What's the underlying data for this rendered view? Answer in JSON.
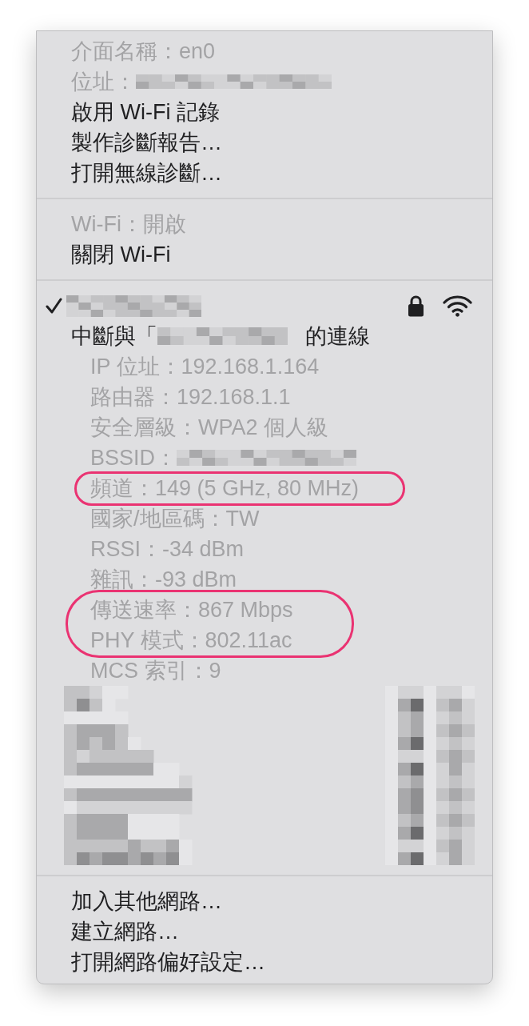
{
  "menu": {
    "sections": [
      {
        "items": [
          {
            "kind": "text",
            "label": "介面名稱：en0",
            "disabled": true
          },
          {
            "kind": "redacted",
            "label": "位址：",
            "disabled": true
          },
          {
            "kind": "text",
            "label": "啟用 Wi-Fi 記錄",
            "disabled": false
          },
          {
            "kind": "text",
            "label": "製作診斷報告…",
            "disabled": false
          },
          {
            "kind": "text",
            "label": "打開無線診斷…",
            "disabled": false
          }
        ]
      },
      {
        "items": [
          {
            "kind": "text",
            "label": "Wi-Fi：開啟",
            "disabled": true
          },
          {
            "kind": "text",
            "label": "關閉 Wi-Fi",
            "disabled": false
          }
        ]
      },
      {
        "items": [
          {
            "kind": "network",
            "checked": true,
            "locked": true
          },
          {
            "kind": "split",
            "label_start": "中斷與「",
            "label_end": "的連線",
            "disabled": false,
            "children": [
              {
                "kind": "text",
                "label": "IP 位址：192.168.1.164",
                "disabled": true,
                "circled": false
              },
              {
                "kind": "text",
                "label": "路由器：192.168.1.1",
                "disabled": true,
                "circled": false
              },
              {
                "kind": "text",
                "label": "安全層級：WPA2 個人級",
                "disabled": true,
                "circled": false
              },
              {
                "kind": "redacted",
                "label": "BSSID：",
                "disabled": true,
                "circled": false
              },
              {
                "kind": "text",
                "label": "頻道：149 (5 GHz, 80 MHz)",
                "disabled": true,
                "circled": true
              },
              {
                "kind": "text",
                "label": "國家/地區碼：TW",
                "disabled": true,
                "circled": false
              },
              {
                "kind": "text",
                "label": "RSSI：-34 dBm",
                "disabled": true,
                "circled": false
              },
              {
                "kind": "text",
                "label": "雜訊：-93 dBm",
                "disabled": true,
                "circled": false
              },
              {
                "kind": "text",
                "label": "傳送速率：867 Mbps",
                "disabled": true,
                "circled": true
              },
              {
                "kind": "text",
                "label": "PHY 模式：802.11ac",
                "disabled": true,
                "circled": true
              },
              {
                "kind": "text",
                "label": "MCS 索引：9",
                "disabled": true,
                "circled": false
              }
            ]
          },
          {
            "kind": "redacted-list"
          }
        ]
      },
      {
        "items": [
          {
            "kind": "text",
            "label": "加入其他網路…",
            "disabled": false
          },
          {
            "kind": "text",
            "label": "建立網路…",
            "disabled": false
          },
          {
            "kind": "text",
            "label": "打開網路偏好設定…",
            "disabled": false
          }
        ]
      }
    ]
  }
}
